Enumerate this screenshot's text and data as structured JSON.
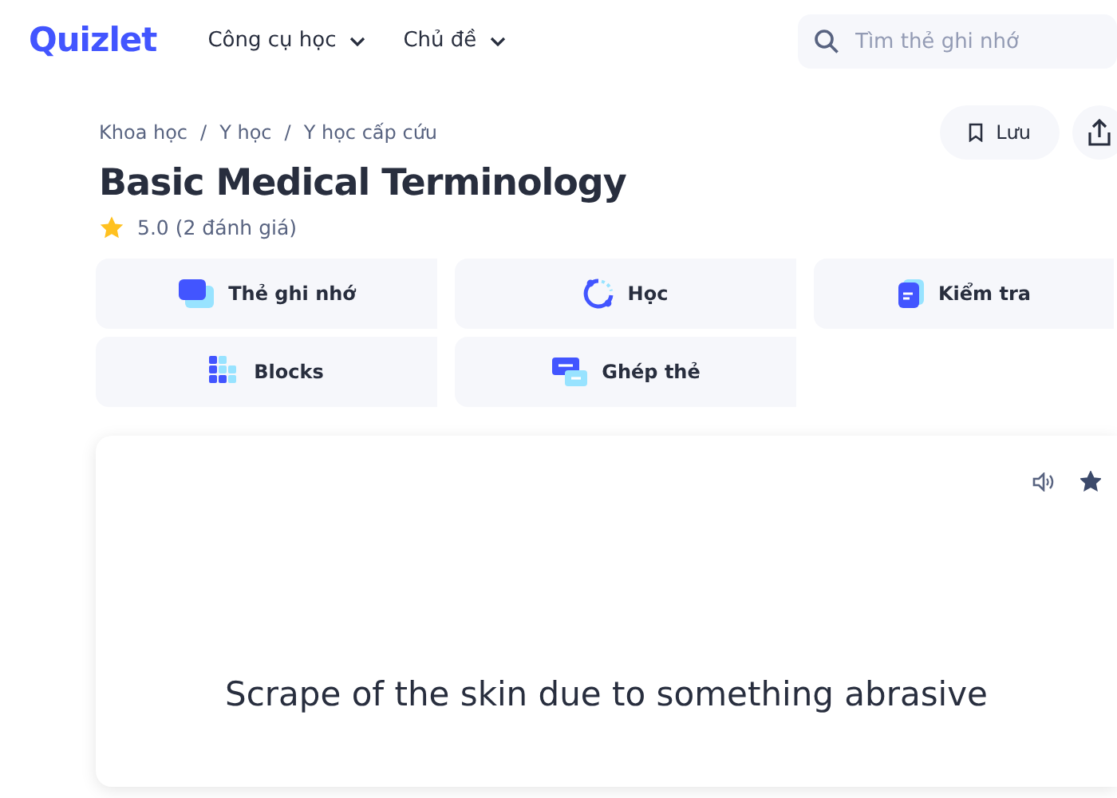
{
  "header": {
    "logo": "Quizlet",
    "menus": [
      {
        "label": "Công cụ học"
      },
      {
        "label": "Chủ đề"
      }
    ],
    "search": {
      "placeholder": "Tìm thẻ ghi nhớ"
    }
  },
  "breadcrumbs": [
    "Khoa học",
    "Y học",
    "Y học cấp cứu"
  ],
  "breadcrumb_separator": "/",
  "actions": {
    "save": "Lưu"
  },
  "title": "Basic Medical Terminology",
  "rating": "5.0 (2 đánh giá)",
  "modes": [
    {
      "label": "Thẻ ghi nhớ",
      "kind": "flashcards"
    },
    {
      "label": "Học",
      "kind": "learn"
    },
    {
      "label": "Kiểm tra",
      "kind": "test"
    },
    {
      "label": "Blocks",
      "kind": "blocks"
    },
    {
      "label": "Ghép thẻ",
      "kind": "match"
    }
  ],
  "flashcard": {
    "term": "Scrape of the skin due to something abrasive",
    "starred": true
  }
}
